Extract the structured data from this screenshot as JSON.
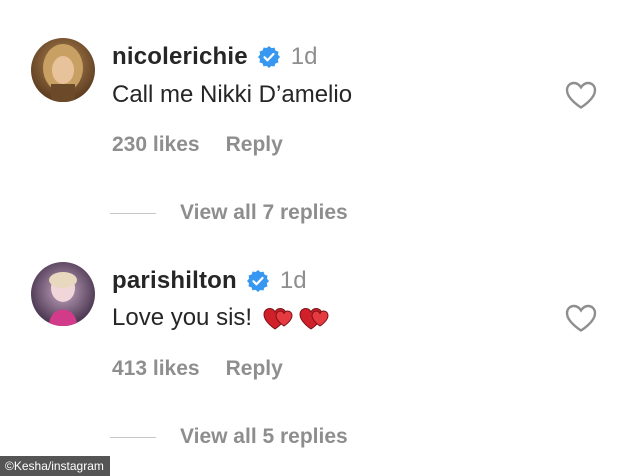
{
  "comments": [
    {
      "username": "nicolerichie",
      "time": "1d",
      "text": "Call me Nikki D’amelio",
      "likes": "230 likes",
      "reply_label": "Reply",
      "view_replies": "View all 7 replies",
      "avatar_icon": "avatar-photo-nicolerichie",
      "verified_icon": "verified-badge-icon"
    },
    {
      "username": "parishilton",
      "time": "1d",
      "text": "Love you sis!",
      "emoji": "two-red-hearts",
      "likes": "413 likes",
      "reply_label": "Reply",
      "view_replies": "View all 5 replies",
      "avatar_icon": "avatar-photo-parishilton",
      "verified_icon": "verified-badge-icon"
    }
  ],
  "credit": "©Kesha/instagram",
  "colors": {
    "text": "#262626",
    "muted": "#8e8e8e",
    "verified": "#3897f0",
    "heart_emoji": "#d0202a",
    "divider": "#c7c7c7"
  }
}
